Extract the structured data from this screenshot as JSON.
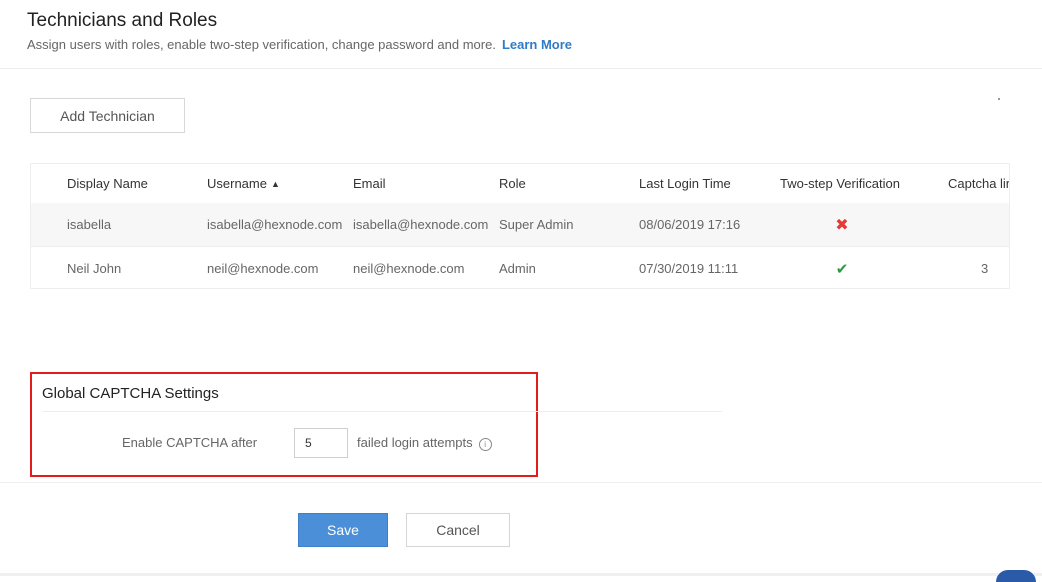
{
  "header": {
    "title": "Technicians and Roles",
    "subtitle": "Assign users with roles, enable two-step verification, change password and more.",
    "learn_more": "Learn More"
  },
  "toolbar": {
    "add_technician": "Add Technician"
  },
  "table": {
    "columns": {
      "display_name": "Display Name",
      "username": "Username",
      "email": "Email",
      "role": "Role",
      "last_login": "Last Login Time",
      "two_step": "Two-step Verification",
      "captcha": "Captcha lir"
    },
    "sort": {
      "column": "username",
      "indicator": "▲"
    },
    "rows": [
      {
        "display_name": "isabella",
        "username": "isabella@hexnode.com",
        "email": "isabella@hexnode.com",
        "role": "Super Admin",
        "last_login": "08/06/2019 17:16",
        "two_step_icon": "cross-icon",
        "two_step_glyph": "✖",
        "captcha": ""
      },
      {
        "display_name": "Neil John",
        "username": "neil@hexnode.com",
        "email": "neil@hexnode.com",
        "role": "Admin",
        "last_login": "07/30/2019 11:11",
        "two_step_icon": "checkmark-icon",
        "two_step_glyph": "✔",
        "captcha": "3"
      }
    ]
  },
  "captcha": {
    "title": "Global CAPTCHA Settings",
    "label": "Enable CAPTCHA after",
    "value": "5",
    "suffix": "failed login attempts",
    "info_glyph": "i"
  },
  "actions": {
    "save": "Save",
    "cancel": "Cancel"
  },
  "colors": {
    "link": "#2f7cc6",
    "primary_button": "#4a8fd8",
    "highlight_border": "#e31b1b",
    "disabled_cross": "#e53935",
    "enabled_check": "#2e9a3c"
  }
}
